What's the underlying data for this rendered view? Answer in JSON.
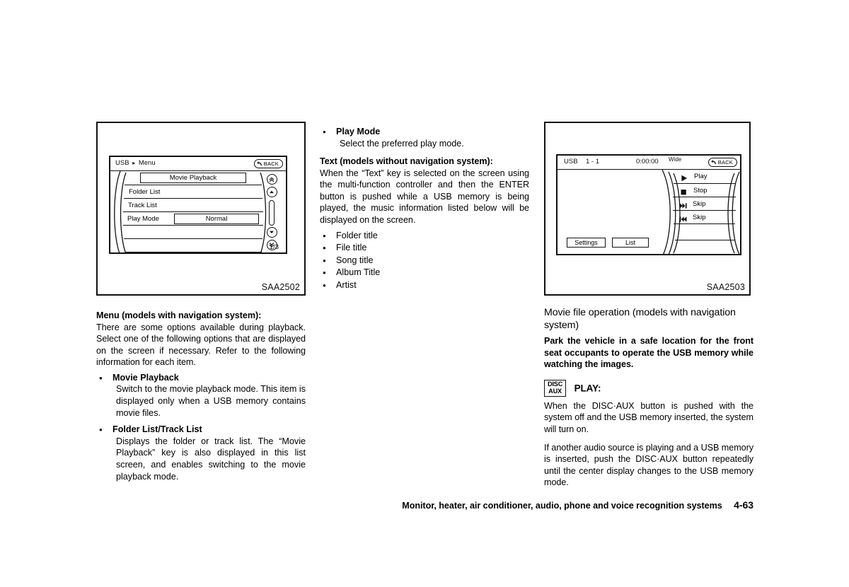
{
  "figure_menu": {
    "caption": "SAA2502",
    "titlebar": {
      "left": "USB",
      "separator": "▸",
      "menu": "Menu",
      "back": "BACK"
    },
    "rows": [
      {
        "label": "",
        "key": "Movie Playback"
      },
      {
        "label": "Folder List",
        "key": ""
      },
      {
        "label": "Track List",
        "key": ""
      },
      {
        "label": "Play Mode",
        "key": "Normal"
      },
      {
        "label": "",
        "key": ""
      },
      {
        "label": "",
        "key": ""
      },
      {
        "label": "",
        "key": ""
      }
    ],
    "page_indicator": "1/3",
    "scroll": {
      "top_fast": "double-chevron-up-icon",
      "up": "chevron-up-icon",
      "thumb": "scrollbar-thumb",
      "down": "chevron-down-icon",
      "bottom_fast": "double-chevron-down-icon"
    }
  },
  "figure_movie": {
    "caption": "SAA2503",
    "titlebar": {
      "source": "USB",
      "track": "1 - 1",
      "time": "0:00:00",
      "aspect": "Wide",
      "back": "BACK"
    },
    "media_keys": [
      {
        "icon": "play-icon",
        "label": "Play"
      },
      {
        "icon": "stop-icon",
        "label": "Stop"
      },
      {
        "icon": "skip-forward-icon",
        "label": "Skip"
      },
      {
        "icon": "skip-back-icon",
        "label": "Skip"
      },
      {
        "icon": "",
        "label": ""
      },
      {
        "icon": "",
        "label": ""
      }
    ],
    "soft_buttons": [
      "Settings",
      "List"
    ]
  },
  "left_column": {
    "heading": "Menu (models with navigation system):",
    "intro": "There are some options available during playback. Select one of the following options that are displayed on the screen if necessary. Refer to the following information for each item.",
    "items": [
      {
        "term": "Movie Playback",
        "desc": "Switch to the movie playback mode. This item is displayed only when a USB memory contains movie files."
      },
      {
        "term": "Folder List/Track List",
        "desc": "Displays the folder or track list. The “Movie Playback” key is also displayed in this list screen, and enables switching to the movie playback mode."
      }
    ]
  },
  "middle_column": {
    "play_mode": {
      "term": "Play Mode",
      "desc": "Select the preferred play mode."
    },
    "text_heading": "Text (models without navigation system):",
    "text_body": "When the “Text” key is selected on the screen using the multi-function controller and then the ENTER button is pushed while a USB memory is being played, the music information listed below will be displayed on the screen.",
    "text_items": [
      "Folder title",
      "File title",
      "Song title",
      "Album Title",
      "Artist"
    ]
  },
  "right_column": {
    "heading": "Movie file operation (models with navigation system)",
    "warning": "Park the vehicle in a safe location for the front seat occupants to operate the USB memory while watching the images.",
    "disc_button": {
      "line1": "DISC",
      "line2": "AUX"
    },
    "play_label": "PLAY:",
    "para1": "When the DISC·AUX button is pushed with the system off and the USB memory inserted, the system will turn on.",
    "para2": "If another audio source is playing and a USB memory is inserted, push the DISC·AUX button repeatedly until the center display changes to the USB memory mode."
  },
  "footer": {
    "title": "Monitor, heater, air conditioner, audio, phone and voice recognition systems",
    "page": "4-63"
  }
}
